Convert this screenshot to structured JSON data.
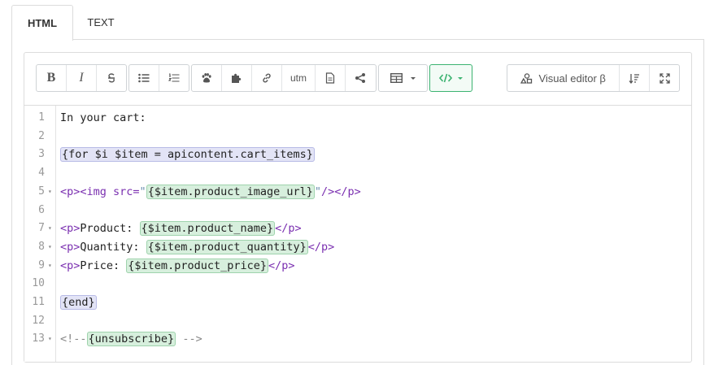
{
  "tabs": [
    {
      "label": "HTML"
    },
    {
      "label": "TEXT"
    }
  ],
  "toolbar": {
    "bold_label": "B",
    "italic_label": "I",
    "utm_label": "utm",
    "visual_editor_label": "Visual editor β"
  },
  "code": {
    "lines": [
      {
        "n": "1",
        "parts": [
          {
            "t": "In your cart:"
          }
        ]
      },
      {
        "n": "2",
        "parts": []
      },
      {
        "n": "3",
        "parts": [
          {
            "t": "{for $i $item = apicontent.cart_items}",
            "c": "hl-blue"
          }
        ]
      },
      {
        "n": "4",
        "parts": []
      },
      {
        "n": "5",
        "fold": true,
        "parts": [
          {
            "t": "<p><img ",
            "c": "tag"
          },
          {
            "t": "src=",
            "c": "tag"
          },
          {
            "t": "\"",
            "c": "str"
          },
          {
            "t": "{$item.product_image_url}",
            "c": "hl-green"
          },
          {
            "t": "\"",
            "c": "str"
          },
          {
            "t": "/></p>",
            "c": "tag"
          }
        ]
      },
      {
        "n": "6",
        "parts": []
      },
      {
        "n": "7",
        "fold": true,
        "parts": [
          {
            "t": "<p>",
            "c": "tag"
          },
          {
            "t": "Product: "
          },
          {
            "t": "{$item.product_name}",
            "c": "hl-green"
          },
          {
            "t": "</p>",
            "c": "tag"
          }
        ]
      },
      {
        "n": "8",
        "fold": true,
        "parts": [
          {
            "t": "<p>",
            "c": "tag"
          },
          {
            "t": "Quantity: "
          },
          {
            "t": "{$item.product_quantity}",
            "c": "hl-green"
          },
          {
            "t": "</p>",
            "c": "tag"
          }
        ]
      },
      {
        "n": "9",
        "fold": true,
        "parts": [
          {
            "t": "<p>",
            "c": "tag"
          },
          {
            "t": "Price: "
          },
          {
            "t": "{$item.product_price}",
            "c": "hl-green"
          },
          {
            "t": "</p>",
            "c": "tag"
          }
        ]
      },
      {
        "n": "10",
        "parts": []
      },
      {
        "n": "11",
        "parts": [
          {
            "t": "{end}",
            "c": "hl-blue"
          }
        ]
      },
      {
        "n": "12",
        "parts": []
      },
      {
        "n": "13",
        "fold": true,
        "parts": [
          {
            "t": "<!--",
            "c": "cmt"
          },
          {
            "t": "{unsubscribe}",
            "c": "hl-green"
          },
          {
            "t": " -->",
            "c": "cmt"
          }
        ]
      }
    ]
  },
  "colors": {
    "accent": "#3cb371",
    "tag": "#7a2fb0",
    "highlight_blue": "#e3e4f6",
    "highlight_green": "#d7efdd"
  }
}
